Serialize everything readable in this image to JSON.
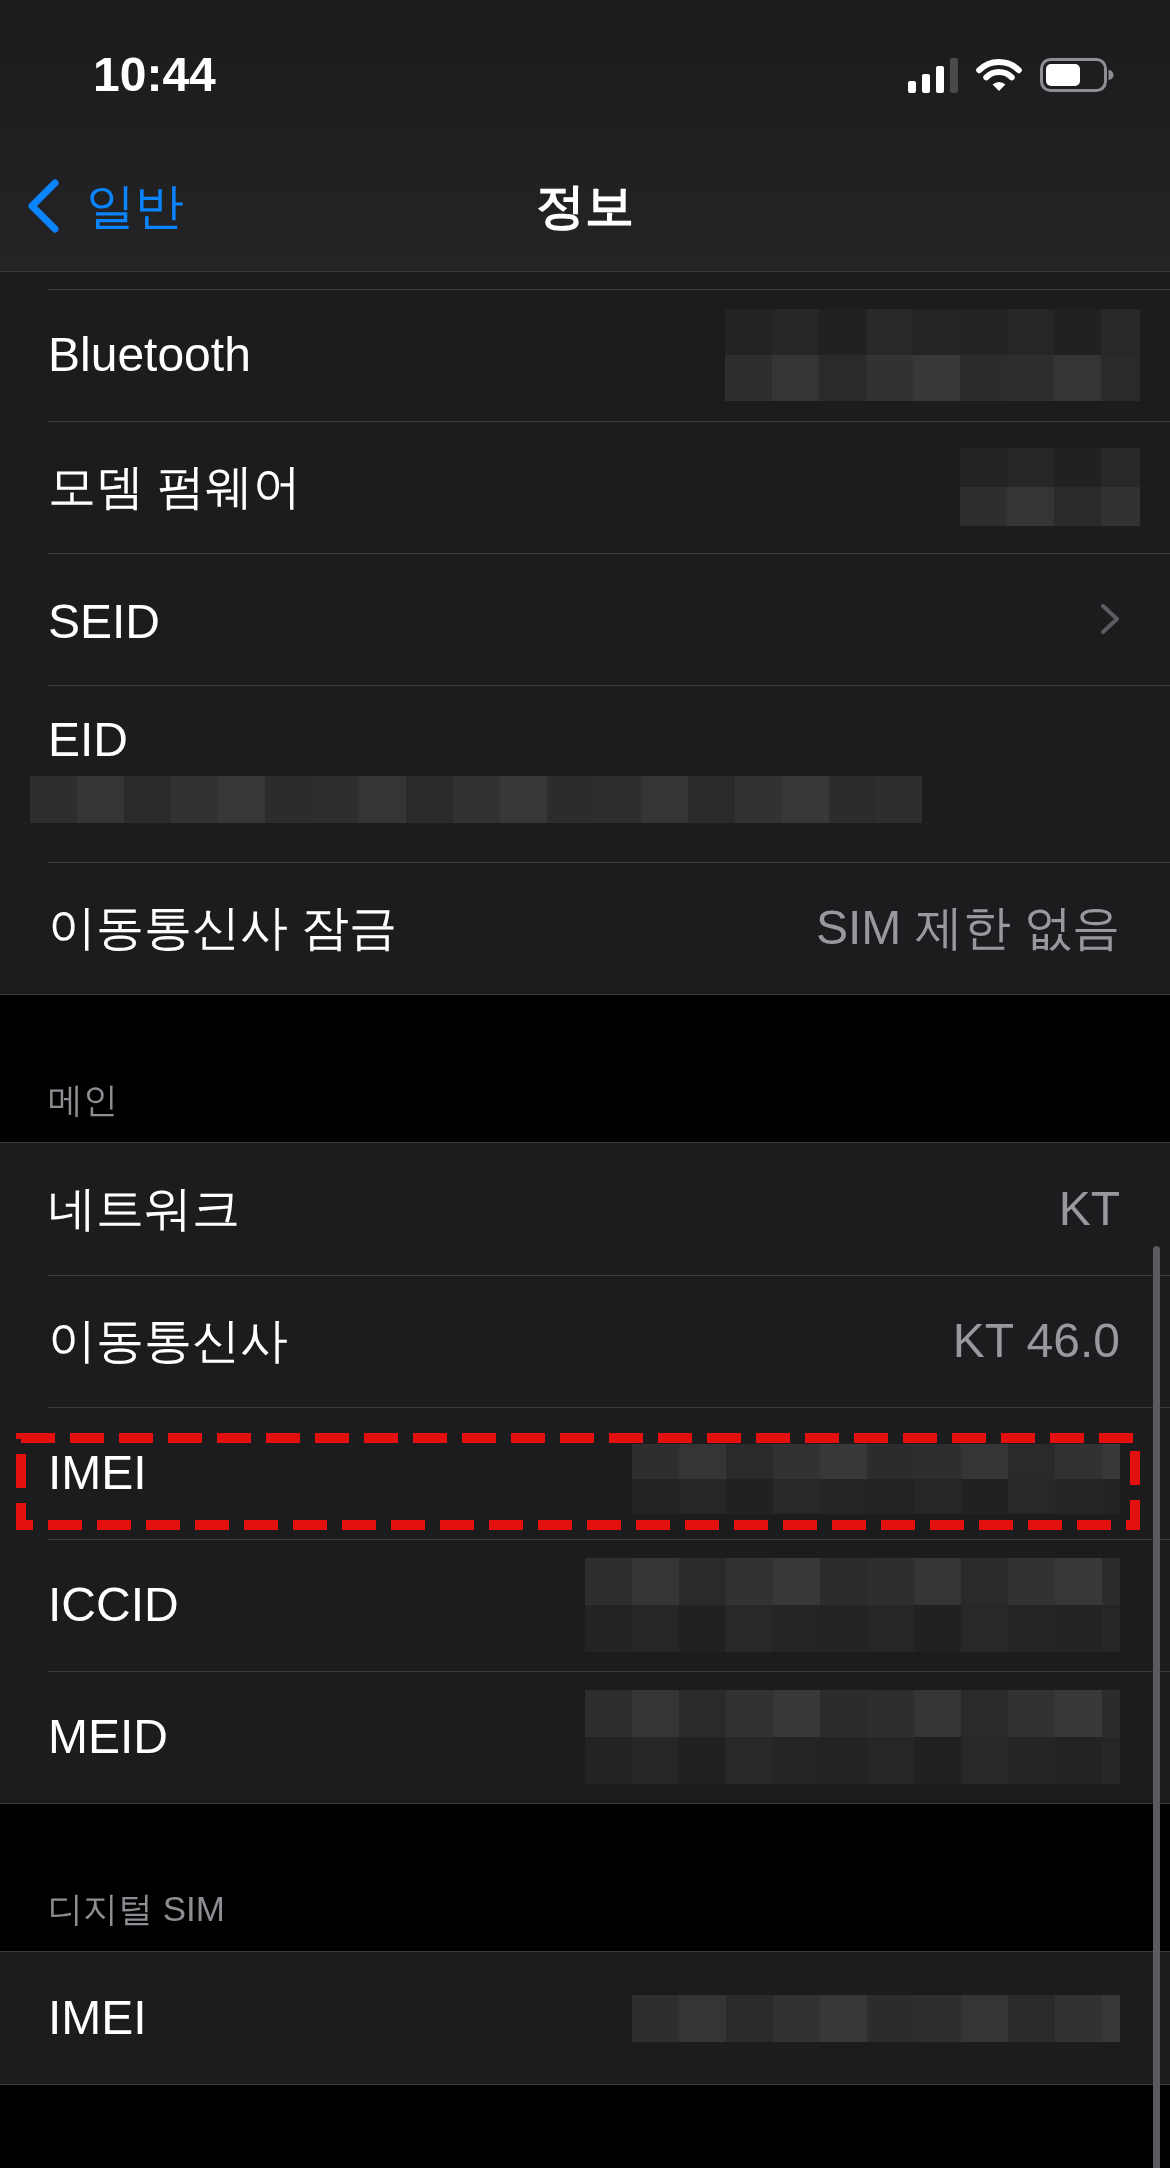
{
  "status_bar": {
    "time": "10:44"
  },
  "navigation": {
    "back_label": "일반",
    "title": "정보"
  },
  "sections": [
    {
      "rows": [
        {
          "label": "Bluetooth",
          "kind": "masked",
          "highlighted": false
        },
        {
          "label": "모뎀 펌웨어",
          "kind": "masked",
          "highlighted": false
        },
        {
          "label": "SEID",
          "kind": "link",
          "highlighted": false
        },
        {
          "label": "EID",
          "kind": "stacked",
          "highlighted": false
        },
        {
          "label": "이동통신사 잠금",
          "kind": "value",
          "value": "SIM 제한 없음",
          "highlighted": false
        }
      ]
    },
    {
      "header": "메인",
      "rows": [
        {
          "label": "네트워크",
          "kind": "value",
          "value": "KT",
          "highlighted": false
        },
        {
          "label": "이동통신사",
          "kind": "value",
          "value": "KT 46.0",
          "highlighted": false
        },
        {
          "label": "IMEI",
          "kind": "masked",
          "highlighted": true
        },
        {
          "label": "ICCID",
          "kind": "masked",
          "highlighted": false
        },
        {
          "label": "MEID",
          "kind": "masked",
          "highlighted": false
        }
      ]
    },
    {
      "header": "디지털 SIM",
      "rows": [
        {
          "label": "IMEI",
          "kind": "masked",
          "highlighted": false
        }
      ]
    }
  ]
}
